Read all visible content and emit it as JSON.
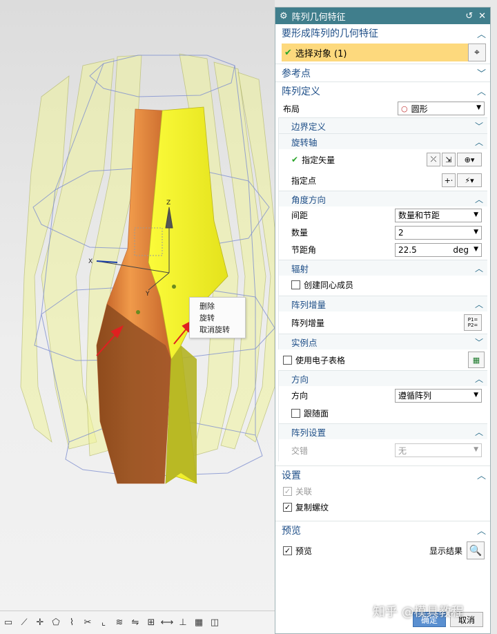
{
  "context_menu": {
    "items": [
      "删除",
      "旋转",
      "取消旋转"
    ]
  },
  "viewport": {
    "axis_x": "X",
    "axis_y": "Y",
    "axis_z": "Z"
  },
  "dialog": {
    "title": "阵列几何特征",
    "sec_geometry": {
      "title": "要形成阵列的几何特征",
      "select_label": "选择对象 (1)"
    },
    "sec_ref": {
      "title": "参考点"
    },
    "sec_def": {
      "title": "阵列定义",
      "layout_label": "布局",
      "layout_value": "圆形",
      "boundary": "边界定义",
      "rot_axis": "旋转轴",
      "spec_vector": "指定矢量",
      "spec_point": "指定点",
      "angle_dir": "角度方向",
      "spacing_label": "间距",
      "spacing_value": "数量和节距",
      "count_label": "数量",
      "count_value": "2",
      "pitch_label": "节距角",
      "pitch_value": "22.5",
      "pitch_unit": "deg",
      "radiate": "辐射",
      "create_concentric": "创建同心成员",
      "pattern_inc": "阵列增量",
      "pattern_inc_label": "阵列增量",
      "instance_pt": "实例点",
      "use_spreadsheet": "使用电子表格",
      "direction": "方向",
      "direction_label": "方向",
      "direction_value": "遵循阵列",
      "follow_face": "跟随面",
      "pattern_settings": "阵列设置",
      "stagger_label": "交错",
      "stagger_value": "无"
    },
    "sec_settings": {
      "title": "设置",
      "associative": "关联",
      "copy_threads": "复制螺纹"
    },
    "sec_preview": {
      "title": "预览",
      "preview": "预览",
      "show_result": "显示结果"
    },
    "ok_label": "确定",
    "cancel_label": "取消"
  },
  "watermark": "知乎 @模具教程",
  "colors": {
    "title_bar": "#407e8c",
    "section_header": "#1f4f88",
    "selection_bar": "#fdd97d",
    "part_orange": "#d9742c",
    "part_yellow": "#f2f02a"
  }
}
